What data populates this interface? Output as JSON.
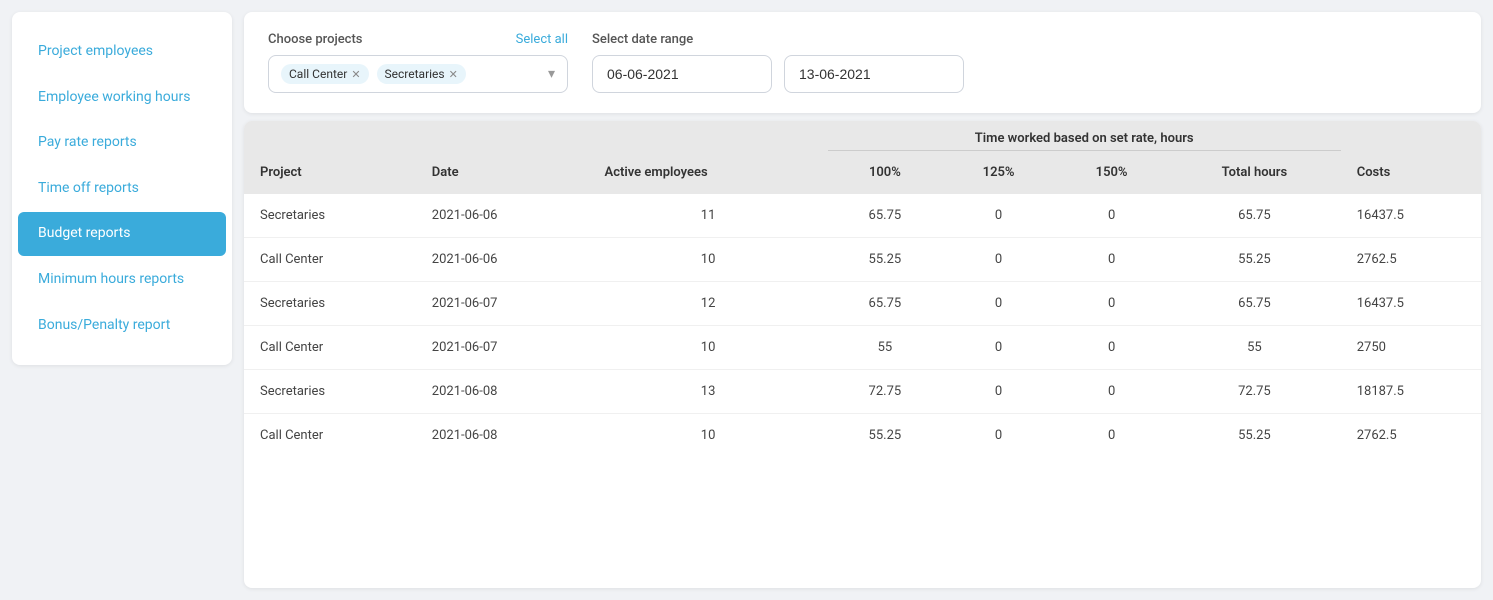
{
  "sidebar": {
    "items": [
      {
        "id": "project-employees",
        "label": "Project employees",
        "active": false
      },
      {
        "id": "employee-working-hours",
        "label": "Employee working hours",
        "active": false
      },
      {
        "id": "pay-rate-reports",
        "label": "Pay rate reports",
        "active": false
      },
      {
        "id": "time-off-reports",
        "label": "Time off reports",
        "active": false
      },
      {
        "id": "budget-reports",
        "label": "Budget reports",
        "active": true
      },
      {
        "id": "minimum-hours-reports",
        "label": "Minimum hours reports",
        "active": false
      },
      {
        "id": "bonus-penalty-report",
        "label": "Bonus/Penalty report",
        "active": false
      }
    ]
  },
  "filter": {
    "projects_label": "Choose projects",
    "select_all": "Select all",
    "selected_projects": [
      "Call Center",
      "Secretaries"
    ],
    "date_range_label": "Select date range",
    "date_from": "06-06-2021",
    "date_to": "13-06-2021"
  },
  "table": {
    "group_header": "Time worked based on set rate, hours",
    "columns": {
      "project": "Project",
      "date": "Date",
      "active_employees": "Active employees",
      "rate_100": "100%",
      "rate_125": "125%",
      "rate_150": "150%",
      "total_hours": "Total hours",
      "costs": "Costs"
    },
    "rows": [
      {
        "project": "Secretaries",
        "date": "2021-06-06",
        "active_employees": "11",
        "rate_100": "65.75",
        "rate_125": "0",
        "rate_150": "0",
        "total_hours": "65.75",
        "costs": "16437.5"
      },
      {
        "project": "Call Center",
        "date": "2021-06-06",
        "active_employees": "10",
        "rate_100": "55.25",
        "rate_125": "0",
        "rate_150": "0",
        "total_hours": "55.25",
        "costs": "2762.5"
      },
      {
        "project": "Secretaries",
        "date": "2021-06-07",
        "active_employees": "12",
        "rate_100": "65.75",
        "rate_125": "0",
        "rate_150": "0",
        "total_hours": "65.75",
        "costs": "16437.5"
      },
      {
        "project": "Call Center",
        "date": "2021-06-07",
        "active_employees": "10",
        "rate_100": "55",
        "rate_125": "0",
        "rate_150": "0",
        "total_hours": "55",
        "costs": "2750"
      },
      {
        "project": "Secretaries",
        "date": "2021-06-08",
        "active_employees": "13",
        "rate_100": "72.75",
        "rate_125": "0",
        "rate_150": "0",
        "total_hours": "72.75",
        "costs": "18187.5"
      },
      {
        "project": "Call Center",
        "date": "2021-06-08",
        "active_employees": "10",
        "rate_100": "55.25",
        "rate_125": "0",
        "rate_150": "0",
        "total_hours": "55.25",
        "costs": "2762.5"
      }
    ]
  }
}
